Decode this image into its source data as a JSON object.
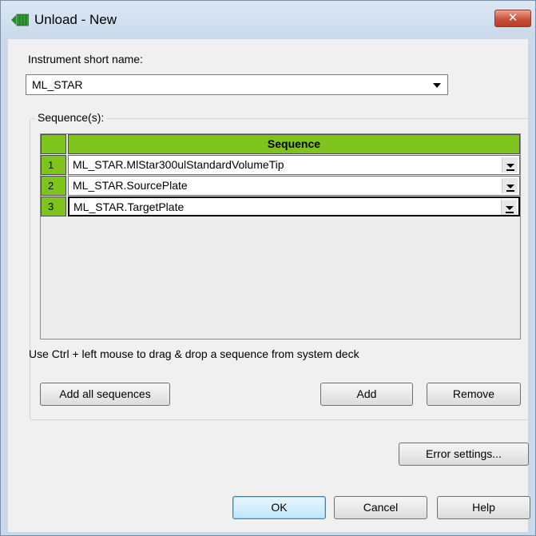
{
  "window": {
    "title": "Unload - New",
    "close_label": "✕"
  },
  "instrument": {
    "label": "Instrument short name:",
    "selected": "ML_STAR"
  },
  "sequences": {
    "group_label": "Sequence(s):",
    "column_header": "Sequence",
    "rows": [
      {
        "num": "1",
        "value": "ML_STAR.MlStar300ulStandardVolumeTip"
      },
      {
        "num": "2",
        "value": "ML_STAR.SourcePlate"
      },
      {
        "num": "3",
        "value": "ML_STAR.TargetPlate"
      }
    ],
    "hint": "Use Ctrl + left mouse to drag & drop a sequence from system deck",
    "add_all_label": "Add all sequences",
    "add_label": "Add",
    "remove_label": "Remove"
  },
  "footer": {
    "error_settings_label": "Error settings...",
    "ok_label": "OK",
    "cancel_label": "Cancel",
    "help_label": "Help"
  },
  "colors": {
    "grid_header": "#7fc41c",
    "titlebar": "#c9d9eb",
    "close_button": "#c8513b"
  },
  "icons": {
    "app": "green-rack-icon",
    "close": "close-icon",
    "dropdown": "chevron-down-icon"
  }
}
